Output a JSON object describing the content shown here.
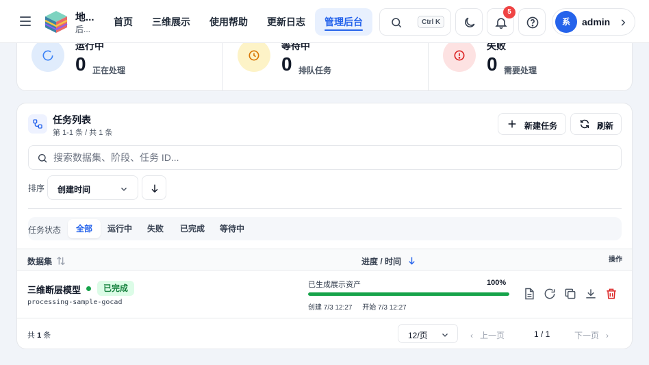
{
  "header": {
    "brand_title": "地...",
    "brand_subtitle": "后...",
    "nav": [
      {
        "label": "首页",
        "active": false
      },
      {
        "label": "三维展示",
        "active": false
      },
      {
        "label": "使用帮助",
        "active": false
      },
      {
        "label": "更新日志",
        "active": false
      },
      {
        "label": "管理后台",
        "active": true
      }
    ],
    "search_shortcut": "Ctrl K",
    "notification_count": "5",
    "user": {
      "avatar_text": "系",
      "name": "admin"
    }
  },
  "stats": [
    {
      "label": "运行中",
      "value": "0",
      "sub": "正在处理",
      "icon": "loader-icon",
      "color": "#3b82f6",
      "bg": "#e0ecfc"
    },
    {
      "label": "等待中",
      "value": "0",
      "sub": "排队任务",
      "icon": "clock-icon",
      "color": "#d97706",
      "bg": "#fdf3c7"
    },
    {
      "label": "失败",
      "value": "0",
      "sub": "需要处理",
      "icon": "alert-circle-icon",
      "color": "#dc2626",
      "bg": "#fde2e2"
    }
  ],
  "tasks": {
    "title": "任务列表",
    "subtitle": "第 1-1 条 / 共 1 条",
    "new_button": "新建任务",
    "refresh_button": "刷新",
    "search_placeholder": "搜索数据集、阶段、任务 ID...",
    "sort_label": "排序",
    "sort_value": "创建时间",
    "filter_label": "任务状态",
    "filters": [
      {
        "label": "全部",
        "active": true
      },
      {
        "label": "运行中",
        "active": false
      },
      {
        "label": "失败",
        "active": false
      },
      {
        "label": "已完成",
        "active": false
      },
      {
        "label": "等待中",
        "active": false
      }
    ],
    "columns": {
      "dataset": "数据集",
      "progress": "进度 / 时间",
      "actions": "操作"
    },
    "rows": [
      {
        "name": "三维断层模型",
        "status": "已完成",
        "id": "processing-sample-gocad",
        "stage": "已生成展示资产",
        "progress_pct": "100%",
        "progress": 1.0,
        "created": "创建 7/3 12:27",
        "started": "开始 7/3 12:27"
      }
    ],
    "footer": {
      "total_prefix": "共",
      "total": "1",
      "total_suffix": "条",
      "page_size": "12/页",
      "prev": "上一页",
      "page": "1 / 1",
      "next": "下一页"
    }
  },
  "colors": {
    "accent": "#2563eb",
    "success": "#16a34a",
    "danger": "#dc2626"
  }
}
